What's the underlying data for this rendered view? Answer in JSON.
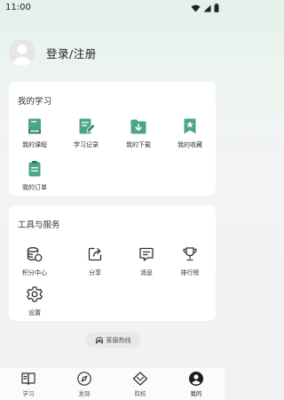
{
  "status_bar": {
    "time": "11:00"
  },
  "profile": {
    "login_text": "登录/注册"
  },
  "study": {
    "title": "我的学习",
    "items": [
      {
        "label": "我的课程",
        "icon": "book-icon"
      },
      {
        "label": "学习记录",
        "icon": "notebook-pencil-icon"
      },
      {
        "label": "我的下载",
        "icon": "download-folder-icon"
      },
      {
        "label": "我的收藏",
        "icon": "bookmark-star-icon"
      },
      {
        "label": "我的订单",
        "icon": "clipboard-icon"
      }
    ]
  },
  "tools": {
    "title": "工具与服务",
    "items": [
      {
        "label": "积分中心",
        "icon": "coins-icon"
      },
      {
        "label": "分享",
        "icon": "share-icon"
      },
      {
        "label": "消息",
        "icon": "message-icon"
      },
      {
        "label": "排行榜",
        "icon": "trophy-icon"
      },
      {
        "label": "设置",
        "icon": "gear-icon"
      }
    ]
  },
  "hotline": {
    "label": "客服热线"
  },
  "tab_bar": {
    "tabs": [
      {
        "label": "学习",
        "icon": "book-open-icon"
      },
      {
        "label": "发现",
        "icon": "compass-icon"
      },
      {
        "label": "院校",
        "icon": "school-icon"
      },
      {
        "label": "我的",
        "icon": "user-icon",
        "active": true
      }
    ]
  },
  "colors": {
    "accent": "#4ca584",
    "background_top": "#e3f1ea",
    "card": "#ffffff"
  }
}
